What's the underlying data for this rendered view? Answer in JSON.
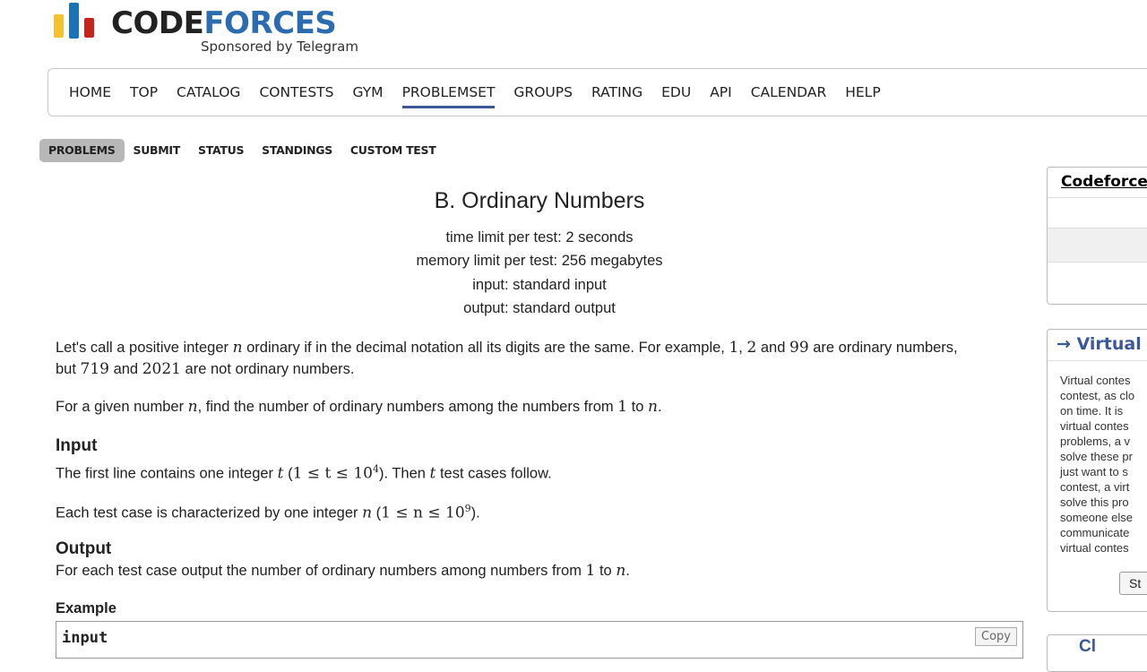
{
  "logo": {
    "word_part1": "CODE",
    "word_part2": "FORCES",
    "sponsor": "Sponsored by Telegram"
  },
  "main_menu": [
    "HOME",
    "TOP",
    "CATALOG",
    "CONTESTS",
    "GYM",
    "PROBLEMSET",
    "GROUPS",
    "RATING",
    "EDU",
    "API",
    "CALENDAR",
    "HELP"
  ],
  "main_menu_active": "PROBLEMSET",
  "second_menu": [
    "PROBLEMS",
    "SUBMIT",
    "STATUS",
    "STANDINGS",
    "CUSTOM TEST"
  ],
  "second_menu_active": "PROBLEMS",
  "problem": {
    "title": "B. Ordinary Numbers",
    "time_limit": "time limit per test: 2 seconds",
    "memory_limit": "memory limit per test: 256 megabytes",
    "input_type": "input: standard input",
    "output_type": "output: standard output",
    "stmt1_a": "Let's call a positive integer ",
    "stmt1_n": "n",
    "stmt1_b": " ordinary if in the decimal notation all its digits are the same. For example, ",
    "stmt1_1": "1",
    "stmt1_c": ", ",
    "stmt1_2": "2",
    "stmt1_d": " and ",
    "stmt1_99": "99",
    "stmt1_e": " are ordinary numbers,",
    "stmt1_f": "but ",
    "stmt1_719": "719",
    "stmt1_g": " and ",
    "stmt1_2021": "2021",
    "stmt1_h": " are not ordinary numbers.",
    "stmt2_a": "For a given number ",
    "stmt2_n": "n",
    "stmt2_b": ", find the number of ordinary numbers among the numbers from ",
    "stmt2_1": "1",
    "stmt2_c": " to ",
    "stmt2_n2": "n",
    "stmt2_d": ".",
    "input_title": "Input",
    "in1_a": "The first line contains one integer ",
    "in1_t": "t",
    "in1_open": " (",
    "in1_range": "1 ≤ t ≤ 10",
    "in1_exp": "4",
    "in1_b": "). Then ",
    "in1_t2": "t",
    "in1_c": " test cases follow.",
    "in2_a": "Each test case is characterized by one integer ",
    "in2_n": "n",
    "in2_open": " (",
    "in2_range": "1 ≤ n ≤ 10",
    "in2_exp": "9",
    "in2_b": ").",
    "output_title": "Output",
    "out_a": "For each test case output the number of ordinary numbers among numbers from ",
    "out_1": "1",
    "out_b": " to ",
    "out_n": "n",
    "out_c": ".",
    "example_label": "Example",
    "sample_input_label": "input",
    "copy_label": "Copy"
  },
  "sidebar": {
    "box1_title": "Codeforces",
    "box2_title": "→ Virtual",
    "box2_text": "Virtual contes\ncontest, as clo\non time. It is \nvirtual contes\nproblems, a v\nsolve these pr\njust want to s\ncontest, a virt\nsolve this pro\nsomeone else\ncommunicate\nvirtual contes",
    "start_label": "St",
    "box3_title": "Cl"
  }
}
